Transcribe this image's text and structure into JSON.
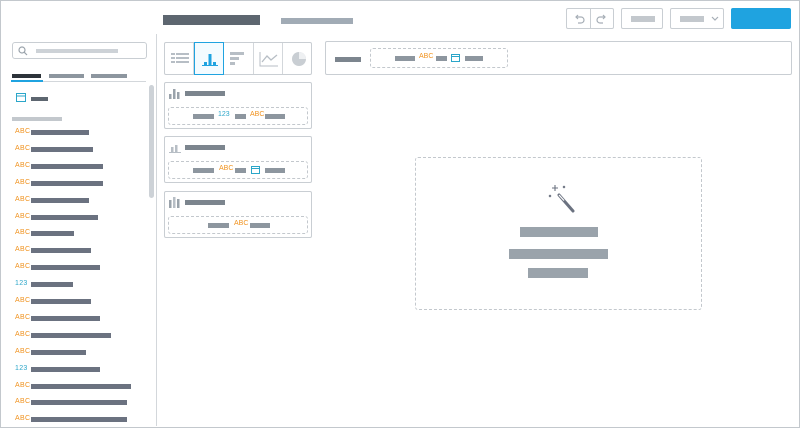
{
  "sidebar": {
    "fields": [
      {
        "type": "ABC"
      },
      {
        "type": "ABC"
      },
      {
        "type": "ABC"
      },
      {
        "type": "ABC"
      },
      {
        "type": "ABC"
      },
      {
        "type": "ABC"
      },
      {
        "type": "ABC"
      },
      {
        "type": "ABC"
      },
      {
        "type": "ABC"
      },
      {
        "type": "123"
      },
      {
        "type": "ABC"
      },
      {
        "type": "ABC"
      },
      {
        "type": "ABC"
      },
      {
        "type": "ABC"
      },
      {
        "type": "123"
      },
      {
        "type": "ABC"
      },
      {
        "type": "ABC"
      },
      {
        "type": "ABC"
      }
    ]
  },
  "chart_types": {
    "selected": "bar"
  },
  "cards": [
    {
      "tokens": [
        "123",
        "ABC"
      ]
    },
    {
      "tokens": [
        "ABC"
      ]
    },
    {
      "tokens": [
        "ABC"
      ]
    }
  ],
  "filter": {
    "token": "ABC"
  },
  "colors": {
    "accent": "#1fa3e0",
    "text_type": "#f0921e",
    "number_type": "#2ba6c9"
  }
}
